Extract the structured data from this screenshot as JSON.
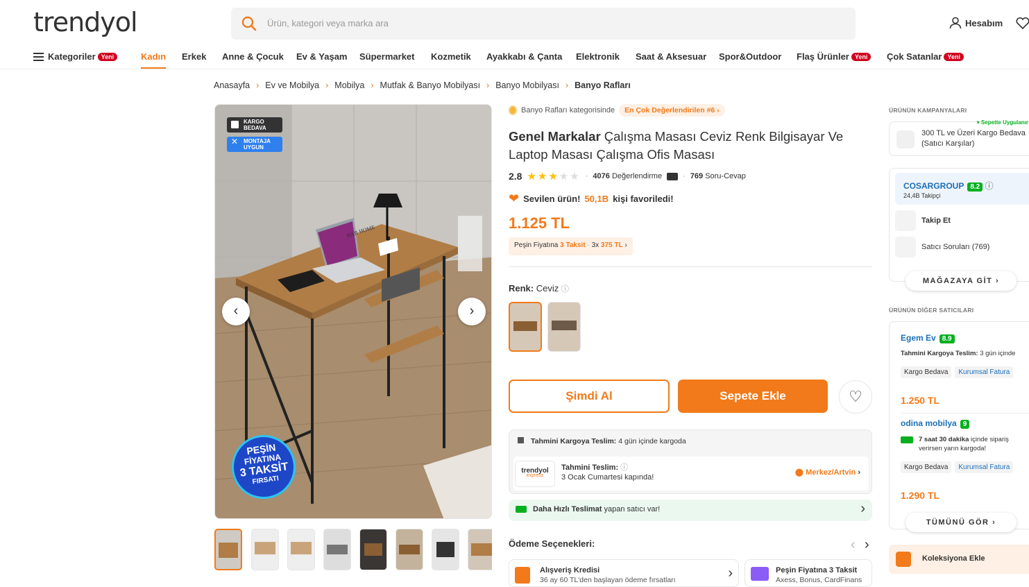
{
  "header": {
    "logo": "trendyol",
    "search_placeholder": "Ürün, kategori veya marka ara",
    "account_label": "Hesabım"
  },
  "nav": {
    "categories_label": "Kategoriler",
    "new_badge": "Yeni",
    "items": [
      "Kadın",
      "Erkek",
      "Anne & Çocuk",
      "Ev & Yaşam",
      "Süpermarket",
      "Kozmetik",
      "Ayakkabı & Çanta",
      "Elektronik",
      "Saat & Aksesuar",
      "Spor&Outdoor",
      "Flaş Ürünler",
      "Çok Satanlar"
    ]
  },
  "breadcrumb": [
    "Anasayfa",
    "Ev ve Mobilya",
    "Mobilya",
    "Mutfak & Banyo Mobilyası",
    "Banyo Mobilyası",
    "Banyo Rafları"
  ],
  "gallery": {
    "badge_shipping": "KARGO BEDAVA",
    "badge_assembly": "MONTAJA UYGUN",
    "promo_line1": "PEŞİN",
    "promo_line2": "FİYATINA",
    "promo_line3": "3 TAKSİT",
    "promo_line4": "FIRSATI",
    "brand_sign": "BAB HOME",
    "thumb_count": 8
  },
  "product": {
    "category_text": "Banyo Rafları kategorisinde",
    "rank_badge": "En Çok Değerlendirilen #6",
    "brand": "Genel Markalar",
    "name": "Çalışma Masası Ceviz Renk Bilgisayar Ve Laptop Masası Çalışma Ofis Masası",
    "rating": "2.8",
    "rating_value": 2.8,
    "review_count": "4076",
    "review_label": "Değerlendirme",
    "qa_count": "769",
    "qa_label": "Soru-Cevap",
    "fav_prefix": "Sevilen ürün!",
    "fav_count": "50,1B",
    "fav_suffix": "kişi favoriledi!",
    "price": "1.125 TL",
    "installment_label": "Peşin Fiyatına",
    "installment_count": "3 Taksit",
    "installment_amount_prefix": "3x",
    "installment_amount": "375 TL",
    "color_label": "Renk:",
    "color_value": "Ceviz",
    "buy_now": "Şimdi Al",
    "add_to_cart": "Sepete Ekle"
  },
  "delivery": {
    "estimate_label": "Tahmini Kargoya Teslim:",
    "estimate_value": "4 gün içinde kargoda",
    "express_logo": "trendyol",
    "express_sub": "express",
    "teslim_label": "Tahmini Teslim:",
    "teslim_value": "3 Ocak Cumartesi kapında!",
    "location": "Merkez/Artvin",
    "faster_bold": "Daha Hızlı Teslimat",
    "faster_rest": "yapan satıcı var!"
  },
  "payment": {
    "title": "Ödeme Seçenekleri:",
    "options": [
      {
        "title": "Alışveriş Kredisi",
        "desc": "36 ay 60 TL'den başlayan ödeme fırsatları"
      },
      {
        "title": "Peşin Fiyatına 3 Taksit",
        "desc": "Axess, Bonus, CardFinans"
      }
    ]
  },
  "sidebar": {
    "campaigns_title": "ÜRÜNÜN KAMPANYALARI",
    "campaign_tag": "Sepette Uygulanır",
    "campaign_text": "300 TL ve Üzeri Kargo Bedava (Satıcı Karşılar)",
    "seller_name": "COSARGROUP",
    "seller_score": "8.2",
    "seller_followers": "24,4B Takipçi",
    "follow": "Takip Et",
    "seller_questions": "Satıcı Soruları (769)",
    "store_button": "MAĞAZAYA GİT",
    "other_sellers_title": "ÜRÜNÜN DİĞER SATICILARI",
    "other_sellers": [
      {
        "name": "Egem Ev",
        "score": "8.9",
        "info_label": "Tahmini Kargoya Teslim:",
        "info_value": "3 gün içinde",
        "tag1": "Kargo Bedava",
        "tag2": "Kurumsal Fatura",
        "price": "1.250 TL"
      },
      {
        "name": "odina mobilya",
        "score": "9",
        "info_bold": "7 saat 30 dakika",
        "info_rest": "içinde sipariş verirsen yarın kargoda!",
        "tag1": "Kargo Bedava",
        "tag2": "Kurumsal Fatura",
        "price": "1.290 TL"
      }
    ],
    "all_button": "TÜMÜNÜ GÖR",
    "collection": "Koleksiyona Ekle"
  },
  "colors": {
    "accent": "#f27a1a",
    "seller_blue": "#1b6fb8",
    "green": "#04b020",
    "new_red": "#d1001f"
  }
}
